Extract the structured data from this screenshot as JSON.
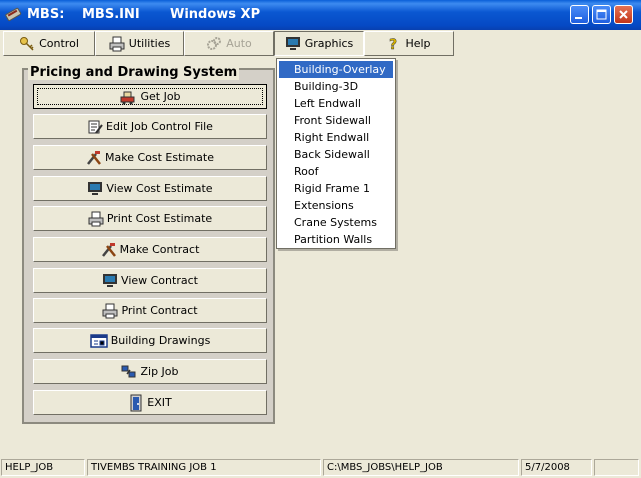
{
  "window": {
    "title_app": "MBS:",
    "title_file": "MBS.INI",
    "title_os": "Windows XP",
    "icon": "mbs-app-icon"
  },
  "menubar": {
    "control": {
      "label": "Control",
      "icon": "key-icon"
    },
    "utilities": {
      "label": "Utilities",
      "icon": "printer-icon"
    },
    "auto": {
      "label": "Auto",
      "icon": "gear-icon"
    },
    "graphics": {
      "label": "Graphics",
      "icon": "monitor-icon"
    },
    "help": {
      "label": "Help",
      "icon": "question-icon"
    }
  },
  "panel": {
    "title": "Pricing and Drawing System",
    "buttons": [
      {
        "label": "Get Job",
        "icon": "truck-icon"
      },
      {
        "label": "Edit Job Control File",
        "icon": "edit-icon"
      },
      {
        "label": "Make Cost Estimate",
        "icon": "tools-icon"
      },
      {
        "label": "View Cost Estimate",
        "icon": "monitor-icon"
      },
      {
        "label": "Print Cost Estimate",
        "icon": "printer-icon"
      },
      {
        "label": "Make Contract",
        "icon": "tools-icon"
      },
      {
        "label": "View Contract",
        "icon": "monitor-icon"
      },
      {
        "label": "Print Contract",
        "icon": "printer-icon"
      },
      {
        "label": "Building Drawings",
        "icon": "drawing-icon"
      },
      {
        "label": "Zip Job",
        "icon": "zip-icon"
      },
      {
        "label": "EXIT",
        "icon": "exit-icon"
      }
    ]
  },
  "graphics_menu": {
    "items": [
      "Building-Overlay",
      "Building-3D",
      "Left Endwall",
      "Front Sidewall",
      "Right Endwall",
      "Back Sidewall",
      "Roof",
      "Rigid Frame 1",
      "Extensions",
      "Crane Systems",
      "Partition Walls"
    ],
    "selected": "Building-Overlay"
  },
  "statusbar": {
    "help": "HELP_JOB",
    "job": "TIVEMBS TRAINING JOB 1",
    "path": "C:\\MBS_JOBS\\HELP_JOB",
    "date": "5/7/2008",
    "extra": ""
  },
  "colors": {
    "titlebar": "#0549c4",
    "selection": "#316ac5",
    "face": "#ece9d8"
  }
}
